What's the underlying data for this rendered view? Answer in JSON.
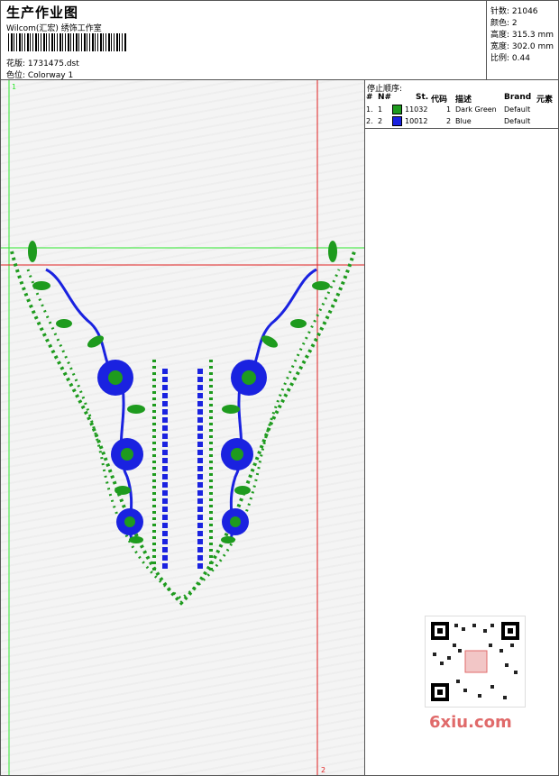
{
  "header": {
    "title": "生产作业图",
    "studio": "Wilcom(汇宏) 绣饰工作室",
    "design_file": "花版: 1731475.dst",
    "colorway": "色位: Colorway 1"
  },
  "stats": {
    "stitches": "针数: 21046",
    "colors": "颜色: 2",
    "height": "高度: 315.3 mm",
    "width": "宽度: 302.0 mm",
    "scale": "比例: 0.44"
  },
  "stop_sequence": {
    "caption": "停止顺序:",
    "headers": [
      "#",
      "N#",
      "St.",
      "代码",
      "描述",
      "Brand",
      "元素"
    ],
    "rows": [
      {
        "idx": "1.",
        "n": "1",
        "color": "#1e9b1e",
        "st": "11032",
        "code": "1",
        "desc": "Dark Green",
        "brand": "Default"
      },
      {
        "idx": "2.",
        "n": "2",
        "color": "#1a22e0",
        "st": "10012",
        "code": "2",
        "desc": "Blue",
        "brand": "Default"
      }
    ]
  },
  "canvas": {
    "guide_labels": [
      "1",
      "2"
    ],
    "colors": {
      "green": "#1e9b1e",
      "blue": "#1a22e0",
      "guide_green": "#2ee82e",
      "guide_red": "#e02020"
    }
  },
  "watermark": {
    "text": "6xiu.com",
    "qr_label": "QR code"
  }
}
